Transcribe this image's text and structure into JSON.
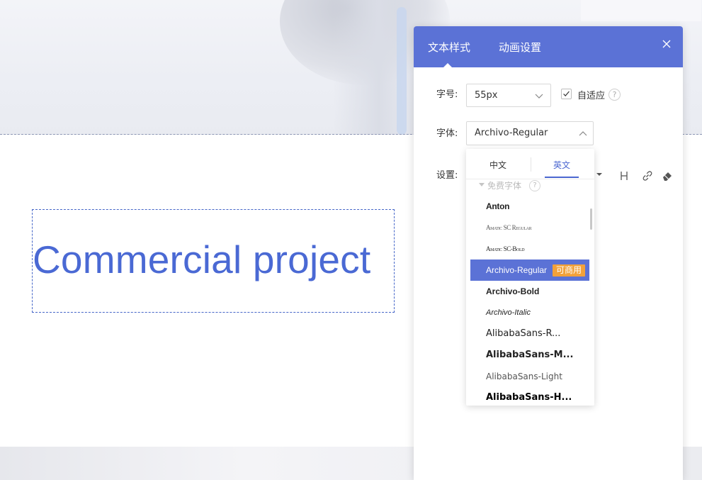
{
  "canvas": {
    "text_box_content": "Commercial project"
  },
  "panel": {
    "tabs": [
      {
        "label": "文本样式",
        "active": true
      },
      {
        "label": "动画设置",
        "active": false
      }
    ],
    "close_icon": "close-icon",
    "size": {
      "label": "字号:",
      "value": "55px"
    },
    "autofit": {
      "label": "自适应",
      "checked": true,
      "help": "?"
    },
    "font": {
      "label": "字体:",
      "value": "Archivo-Regular"
    },
    "settings": {
      "label": "设置:"
    },
    "toolbar_icons": [
      "chevron-down-icon",
      "heading-icon",
      "link-icon",
      "eraser-icon"
    ]
  },
  "font_dropdown": {
    "tabs": [
      {
        "label": "中文",
        "active": false
      },
      {
        "label": "英文",
        "active": true
      }
    ],
    "group": {
      "label": "免费字体",
      "help": "?"
    },
    "items": [
      {
        "label": "Anton"
      },
      {
        "label": "Amatic SC Regular"
      },
      {
        "label": "Amatic SC-Bold"
      },
      {
        "label": "Archivo-Regular",
        "selected": true,
        "tag": "可商用"
      },
      {
        "label": "Archivo-Bold"
      },
      {
        "label": "Archivo-Italic"
      },
      {
        "label": "AlibabaSans-R..."
      },
      {
        "label": "AlibabaSans-M..."
      },
      {
        "label": "AlibabaSans-Light"
      },
      {
        "label": "AlibabaSans-H..."
      }
    ]
  },
  "colors": {
    "panel_header": "#5b72d6",
    "accent": "#4a66d0",
    "canvas_text": "#4a69d4",
    "tag_bg": "#f2a13a"
  }
}
